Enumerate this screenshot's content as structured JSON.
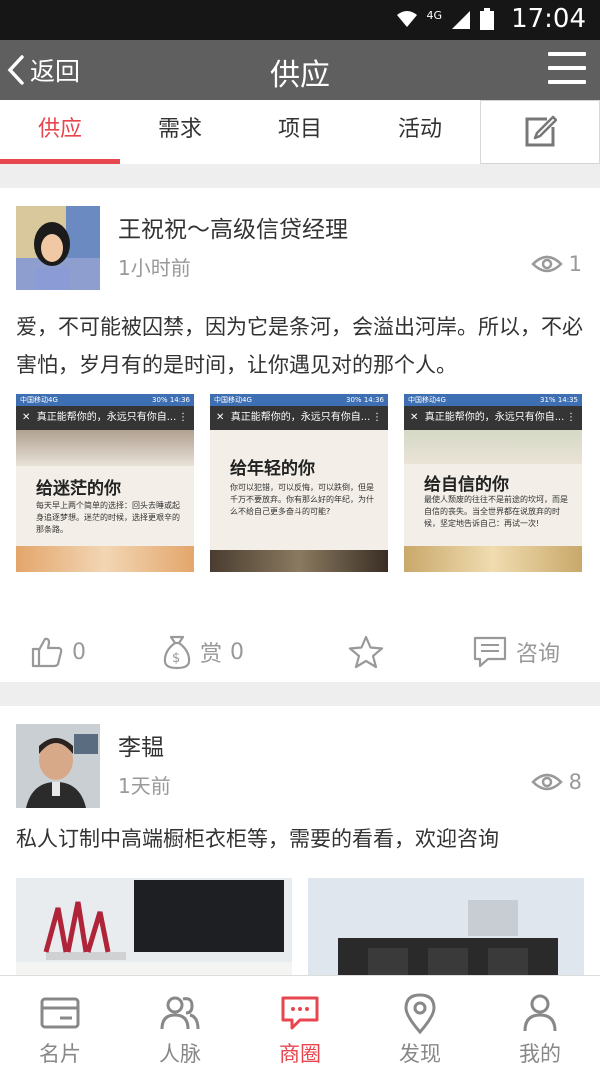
{
  "status_bar": {
    "time": "17:04",
    "network": "4G"
  },
  "navbar": {
    "back_label": "返回",
    "title": "供应"
  },
  "tabs": [
    {
      "label": "供应",
      "active": true
    },
    {
      "label": "需求",
      "active": false
    },
    {
      "label": "项目",
      "active": false
    },
    {
      "label": "活动",
      "active": false
    }
  ],
  "posts": [
    {
      "author": "王祝祝～高级信贷经理",
      "time": "1小时前",
      "views": "1",
      "content": "爱，不可能被囚禁，因为它是条河，会溢出河岸。所以，不必害怕，岁月有的是时间，让你遇见对的那个人。",
      "images": [
        {
          "carrier": "中国移动4G",
          "battery": "30%",
          "clock": "14:36",
          "article_title": "真正能帮你的，永远只有你自...",
          "heading": "给迷茫的你",
          "body": "每天早上两个简单的选择：回头去睡或起身追逐梦想。迷茫的时候，选择更艰辛的那条路。"
        },
        {
          "carrier": "中国移动4G",
          "battery": "30%",
          "clock": "14:36",
          "article_title": "真正能帮你的，永远只有你自...",
          "heading": "给年轻的你",
          "body": "你可以犯错，可以反悔，可以跌倒，但是千万不要放弃。你有那么好的年纪，为什么不给自己更多奋斗的可能?"
        },
        {
          "carrier": "中国移动4G",
          "battery": "31%",
          "clock": "14:35",
          "article_title": "真正能帮你的，永远只有你自...",
          "heading": "给自信的你",
          "body": "最使人颓废的往往不是前途的坎坷，而是自信的丧失。当全世界都在说放弃的时候，坚定地告诉自己：再试一次!"
        }
      ],
      "likes": "0",
      "reward_label": "赏",
      "reward_count": "0",
      "consult_label": "咨询"
    },
    {
      "author": "李韫",
      "time": "1天前",
      "views": "8",
      "content": "私人订制中高端橱柜衣柜等，需要的看看，欢迎咨询"
    }
  ],
  "bottom_nav": [
    {
      "label": "名片",
      "icon": "card-icon",
      "active": false
    },
    {
      "label": "人脉",
      "icon": "contacts-icon",
      "active": false
    },
    {
      "label": "商圈",
      "icon": "chat-icon",
      "active": true
    },
    {
      "label": "发现",
      "icon": "location-icon",
      "active": false
    },
    {
      "label": "我的",
      "icon": "profile-icon",
      "active": false
    }
  ],
  "colors": {
    "accent": "#e8464e",
    "navbar": "#5f5f5f",
    "status": "#161616"
  }
}
